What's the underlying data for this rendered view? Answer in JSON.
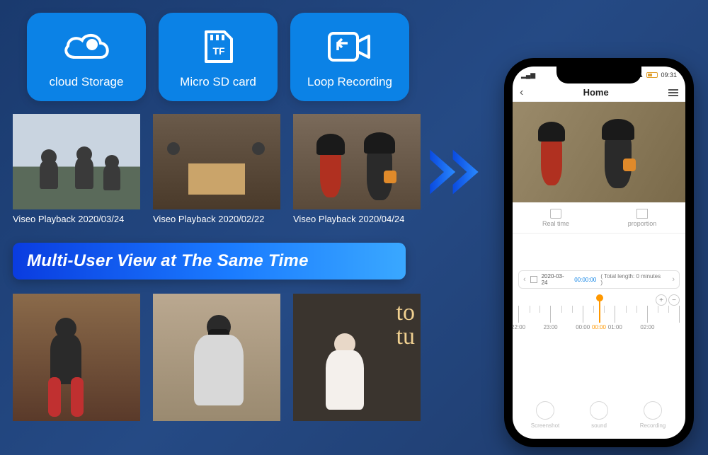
{
  "features": [
    {
      "label": "cloud Storage"
    },
    {
      "label": "Micro SD card"
    },
    {
      "label": "Loop Recording"
    }
  ],
  "playbacks": [
    {
      "caption": "Viseo Playback 2020/03/24"
    },
    {
      "caption": "Viseo Playback 2020/02/22"
    },
    {
      "caption": "Viseo Playback 2020/04/24"
    }
  ],
  "heading": "Multi-User View at The Same Time",
  "phone": {
    "status_time": "09:31",
    "title": "Home",
    "tabs": {
      "realtime": "Real time",
      "proportion": "proportion"
    },
    "date": "2020-03-24",
    "time": "00:00:00",
    "length_note": "( Total length: 0 minutes )",
    "ticks": [
      "22:00",
      "23:00",
      "00:00",
      "01:00",
      "02:00"
    ],
    "marker": "00:00",
    "buttons": {
      "screenshot": "Screenshot",
      "sound": "sound",
      "recording": "Recording"
    }
  }
}
